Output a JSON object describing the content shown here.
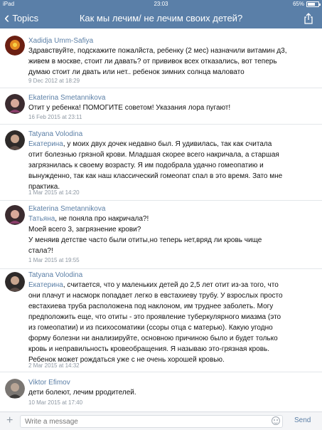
{
  "status_bar": {
    "carrier": "iPad",
    "time": "23:03",
    "battery": "65%"
  },
  "nav": {
    "back_label": "Topics",
    "title": "Как  мы лечим/ не лечим своих детей?"
  },
  "messages": [
    {
      "author": "Xadidja Umm-Safiya",
      "lines": [
        "Здравствуйте, подскажите пожалйста, ребенку (2 мес) назначили витамин д3,",
        "живем в москве, стоит ли  давать?  от прививок  всех отказались, вот теперь",
        "думаю стоит ли двать или нет.. ребенок  зимних солнца  маловато"
      ],
      "date": "9 Dec 2012 at 18:29"
    },
    {
      "author": "Ekaterina Smetannikova",
      "lines": [
        "Отит у ребенка! ПОМОГИТЕ советом! Указания лора пугают!"
      ],
      "date": "16 Feb 2015 at 23:11"
    },
    {
      "author": "Tatyana Volodina",
      "mention": "Екатерина",
      "first_rest": ", у моих двух дочек недавно был. Я удивилась, так как считала",
      "lines": [
        "отит болезнью грязной крови. Младшая скорее всего накричала, а старшая",
        "загрязнилась к своему возрасту. Я им подобрала удачно гомеопатию и",
        "вынужденно, так как наш классический гомеопат спал в это время. Зато мне",
        "практика."
      ],
      "date": "1 Mar 2015 at 14:20"
    },
    {
      "author": "Ekaterina Smetannikova",
      "mention": "Татьяна",
      "first_rest": ", не поняла про накричала?!",
      "lines": [
        "Моей всего 3, загрязнение крови?",
        "У меняив детстве часто были отиты,но теперь нет,вряд ли кровь чище",
        "стала?!"
      ],
      "date": "1 Mar 2015 at 19:55"
    },
    {
      "author": "Tatyana Volodina",
      "mention": "Екатерина",
      "first_rest": ", считается, что у маленьких детей до 2,5 лет отит из-за того, что",
      "lines": [
        "они плачут и насморк попадает легко в евстахиеву трубу. У взрослых просто",
        "евстахиева труба расположена под наклоном, им труднее заболеть. Могу",
        "предположить еще, что отиты - это проявление туберкулярного миазма (это",
        "из гомеопатии) и из психосоматики (ссоры отца с матерью). Какую угодно",
        "форму болезни ни анализируйте, основною причиною было и будет только",
        "кровь и неправильность кровеобращения. Я называю это-грязная кровь.",
        "Ребенок может рождаться уже с не очень хорошей кровью."
      ],
      "date": "2 Mar 2015 at 14:32"
    },
    {
      "author": "Viktor Efimov",
      "lines": [
        "дети болеют, лечим рродителей."
      ],
      "date": "10 Mar 2015 at 17:40"
    }
  ],
  "composer": {
    "placeholder": "Write a message",
    "send_label": "Send"
  },
  "colors": {
    "header": "#5a7fa8",
    "accent": "#5b7fa6",
    "meta": "#8e98a3"
  }
}
